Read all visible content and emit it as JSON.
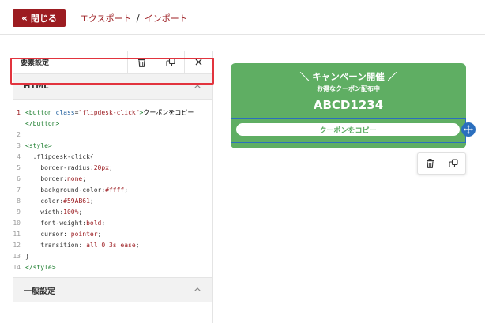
{
  "topbar": {
    "close_label": "閉じる",
    "breadcrumb_export": "エクスポート",
    "breadcrumb_sep": "/",
    "breadcrumb_import": "インポート"
  },
  "panel": {
    "title": "要素設定",
    "html_section": "HTML",
    "general_section": "一般設定"
  },
  "code_lines": [
    {
      "n": "1",
      "parts": [
        [
          "tag",
          "<button "
        ],
        [
          "attr",
          "class"
        ],
        [
          "code",
          "="
        ],
        [
          "str",
          "\"flipdesk-click\""
        ],
        [
          "tag",
          ">"
        ],
        [
          "txt",
          "クーポンをコピー"
        ]
      ]
    },
    {
      "n": "",
      "parts": [
        [
          "tag",
          "</button>"
        ]
      ]
    },
    {
      "n": "2",
      "parts": []
    },
    {
      "n": "3",
      "parts": [
        [
          "tag",
          "<style>"
        ]
      ]
    },
    {
      "n": "4",
      "parts": [
        [
          "code",
          "  .flipdesk-click{"
        ]
      ]
    },
    {
      "n": "5",
      "parts": [
        [
          "code",
          "    border-radius:"
        ],
        [
          "val",
          "20px"
        ],
        [
          "code",
          ";"
        ]
      ]
    },
    {
      "n": "6",
      "parts": [
        [
          "code",
          "    border:"
        ],
        [
          "val",
          "none"
        ],
        [
          "code",
          ";"
        ]
      ]
    },
    {
      "n": "7",
      "parts": [
        [
          "code",
          "    background-color:"
        ],
        [
          "val",
          "#ffff"
        ],
        [
          "code",
          ";"
        ]
      ]
    },
    {
      "n": "8",
      "parts": [
        [
          "code",
          "    color:"
        ],
        [
          "val",
          "#59AB61"
        ],
        [
          "code",
          ";"
        ]
      ]
    },
    {
      "n": "9",
      "parts": [
        [
          "code",
          "    width:"
        ],
        [
          "val",
          "100%"
        ],
        [
          "code",
          ";"
        ]
      ]
    },
    {
      "n": "10",
      "parts": [
        [
          "code",
          "    font-weight:"
        ],
        [
          "val",
          "bold"
        ],
        [
          "code",
          ";"
        ]
      ]
    },
    {
      "n": "11",
      "parts": [
        [
          "code",
          "    cursor: "
        ],
        [
          "val",
          "pointer"
        ],
        [
          "code",
          ";"
        ]
      ]
    },
    {
      "n": "12",
      "parts": [
        [
          "code",
          "    transition: "
        ],
        [
          "val",
          "all 0.3s ease"
        ],
        [
          "code",
          ";"
        ]
      ]
    },
    {
      "n": "13",
      "parts": [
        [
          "code",
          "}"
        ]
      ]
    },
    {
      "n": "14",
      "parts": [
        [
          "tag",
          "</style>"
        ]
      ]
    }
  ],
  "preview": {
    "banner_title": "＼ キャンペーン開催 ／",
    "banner_sub": "お得なクーポン配布中",
    "coupon_code": "ABCD1234",
    "copy_button": "クーポンをコピー"
  },
  "colors": {
    "brand": "#9c1c21",
    "banner_bg": "#5fae63",
    "button_text": "#59AB61",
    "selection": "#2b6fbe",
    "highlight": "#e2343e"
  },
  "icons": {
    "close_chevrons": "double-chevron-left-icon",
    "trash": "trash-icon",
    "duplicate": "duplicate-icon",
    "close": "close-icon",
    "collapse": "chevron-up-icon",
    "move": "move-icon"
  }
}
